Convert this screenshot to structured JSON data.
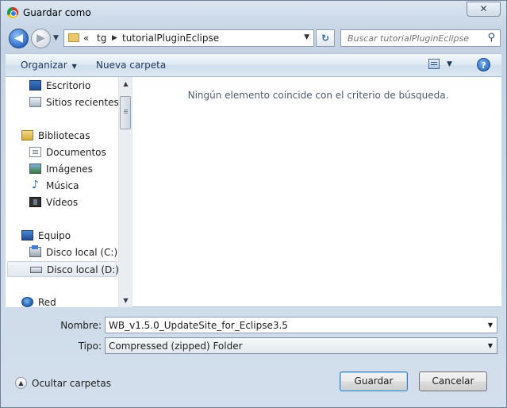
{
  "window": {
    "title": "Guardar como",
    "close_label": "✕"
  },
  "navigation": {
    "back_glyph": "◀",
    "forward_glyph": "▶",
    "breadcrumbs": [
      "«",
      "tg",
      "tutorialPluginEclipse"
    ],
    "refresh_glyph": "↻"
  },
  "search": {
    "placeholder": "Buscar tutorialPluginEclipse"
  },
  "toolbar": {
    "organize_label": "Organizar",
    "new_folder_label": "Nueva carpeta",
    "help_label": "?"
  },
  "sidebar": {
    "items": [
      {
        "label": "Escritorio",
        "icon": "desktop-icon"
      },
      {
        "label": "Sitios recientes",
        "icon": "recent-places-icon"
      },
      {
        "label": "Bibliotecas",
        "icon": "libraries-icon"
      },
      {
        "label": "Documentos",
        "icon": "documents-icon"
      },
      {
        "label": "Imágenes",
        "icon": "pictures-icon"
      },
      {
        "label": "Música",
        "icon": "music-icon"
      },
      {
        "label": "Vídeos",
        "icon": "videos-icon"
      },
      {
        "label": "Equipo",
        "icon": "computer-icon"
      },
      {
        "label": "Disco local (C:)",
        "icon": "drive-c-icon"
      },
      {
        "label": "Disco local (D:)",
        "icon": "drive-d-icon",
        "selected": true
      },
      {
        "label": "Red",
        "icon": "network-icon"
      }
    ]
  },
  "main": {
    "empty_message": "Ningún elemento coincide con el criterio de búsqueda."
  },
  "form": {
    "filename_label": "Nombre:",
    "filename_value": "WB_v1.5.0_UpdateSite_for_Eclipse3.5",
    "filetype_label": "Tipo:",
    "filetype_value": "Compressed (zipped) Folder"
  },
  "footer": {
    "hide_folders_label": "Ocultar carpetas",
    "save_label": "Guardar",
    "cancel_label": "Cancelar"
  }
}
